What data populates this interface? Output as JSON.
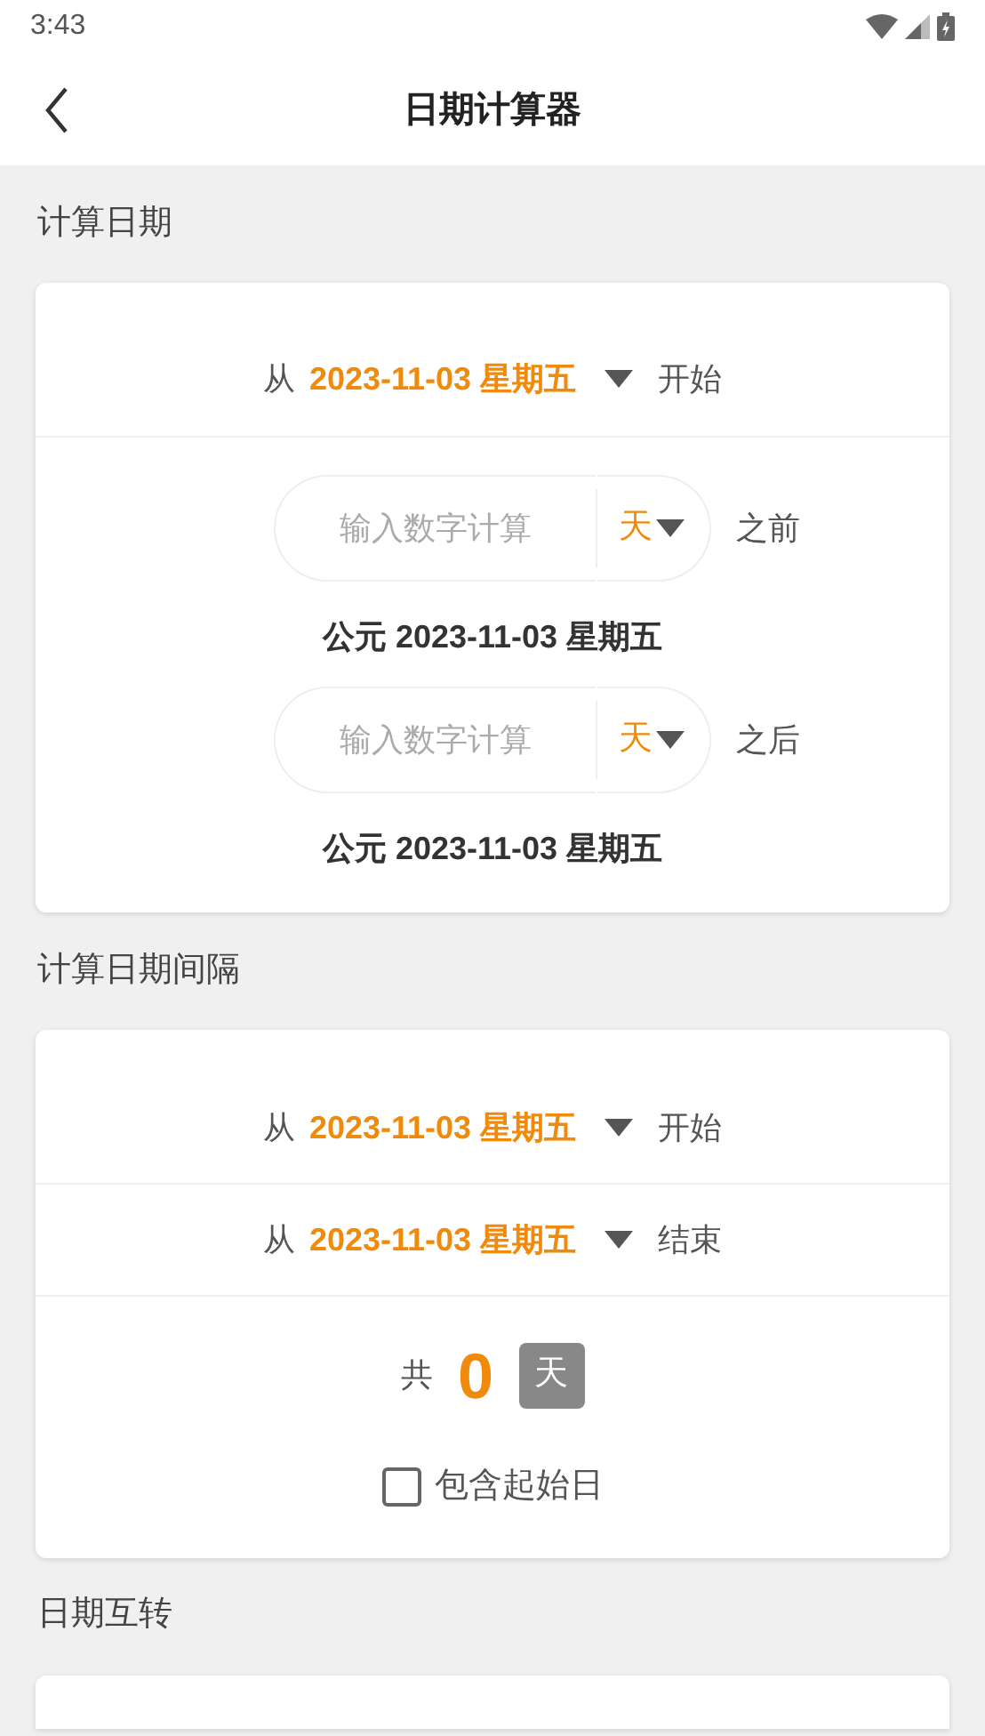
{
  "status_bar": {
    "time": "3:43"
  },
  "header": {
    "title": "日期计算器"
  },
  "sections": [
    {
      "kind": "offset",
      "title": "计算日期",
      "start": {
        "prefix": "从",
        "date": "2023-11-03 星期五",
        "suffix": "开始"
      },
      "offsets": [
        {
          "placeholder": "输入数字计算",
          "unit": "天",
          "direction": "之前",
          "result": "公元 2023-11-03 星期五"
        },
        {
          "placeholder": "输入数字计算",
          "unit": "天",
          "direction": "之后",
          "result": "公元 2023-11-03 星期五"
        }
      ]
    },
    {
      "kind": "interval",
      "title": "计算日期间隔",
      "dates": [
        {
          "prefix": "从",
          "date": "2023-11-03 星期五",
          "suffix": "开始"
        },
        {
          "prefix": "从",
          "date": "2023-11-03 星期五",
          "suffix": "结束"
        }
      ],
      "total": {
        "prefix": "共",
        "value": "0",
        "unit": "天"
      },
      "include_start": {
        "label": "包含起始日",
        "checked": false
      }
    },
    {
      "kind": "convert",
      "title": "日期互转"
    }
  ]
}
